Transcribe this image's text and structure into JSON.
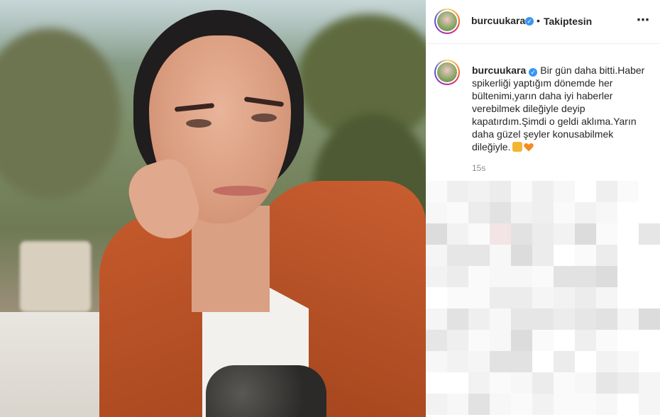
{
  "post": {
    "header": {
      "username": "burcuukara",
      "verified": true,
      "separator": "•",
      "follow_status": "Takiptesin",
      "more_icon": "⋯"
    },
    "caption": {
      "username": "burcuukara",
      "text": "Bir gün daha bitti.Haber spikerliği yaptığım dönemde her bültenimi,yarın daha iyi haberler verebilmek dileğiyle deyip kapatırdım.Şimdi o geldi aklıma.Yarın daha güzel şeyler konusabilmek dileğiyle.",
      "emojis": [
        "folded-hands",
        "orange-heart"
      ]
    },
    "time_ago": "15s"
  },
  "colors": {
    "verified_blue": "#3897f0",
    "text": "#262626",
    "muted": "#8e8e8e"
  }
}
